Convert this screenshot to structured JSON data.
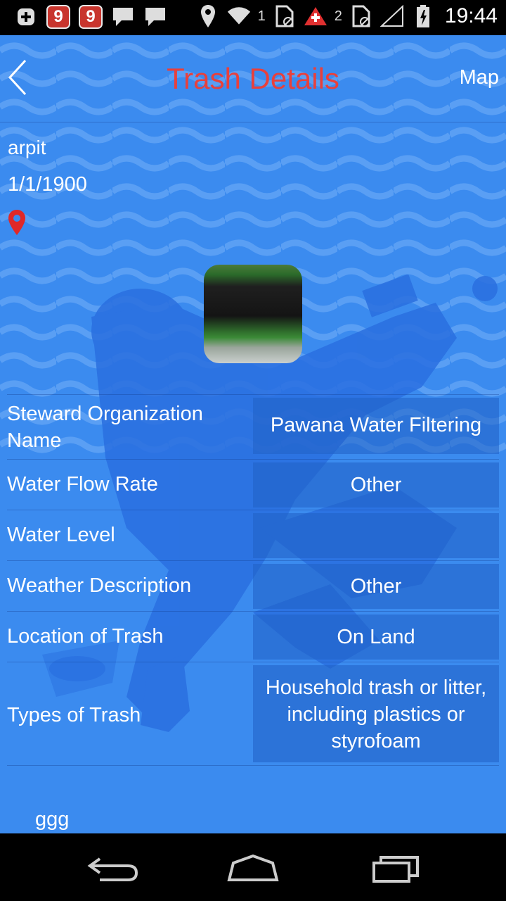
{
  "status_bar": {
    "app_badge_1": "9",
    "app_badge_2": "9",
    "sim1": "1",
    "sim2": "2",
    "time": "19:44"
  },
  "header": {
    "title": "Trash Details",
    "map_label": "Map",
    "title_color": "#e8403c"
  },
  "report": {
    "user": "arpit",
    "date": "1/1/1900"
  },
  "details": [
    {
      "label": "Steward Organization Name",
      "value": "Pawana Water Filtering"
    },
    {
      "label": "Water Flow Rate",
      "value": "Other"
    },
    {
      "label": "Water Level",
      "value": ""
    },
    {
      "label": "Weather Description",
      "value": "Other"
    },
    {
      "label": "Location of Trash",
      "value": "On Land"
    },
    {
      "label": "Types of Trash",
      "value": "Household trash or litter, including plastics or styrofoam"
    }
  ],
  "notes": "ggg",
  "colors": {
    "background": "#3b8bef",
    "value_cell": "#2160c4"
  }
}
